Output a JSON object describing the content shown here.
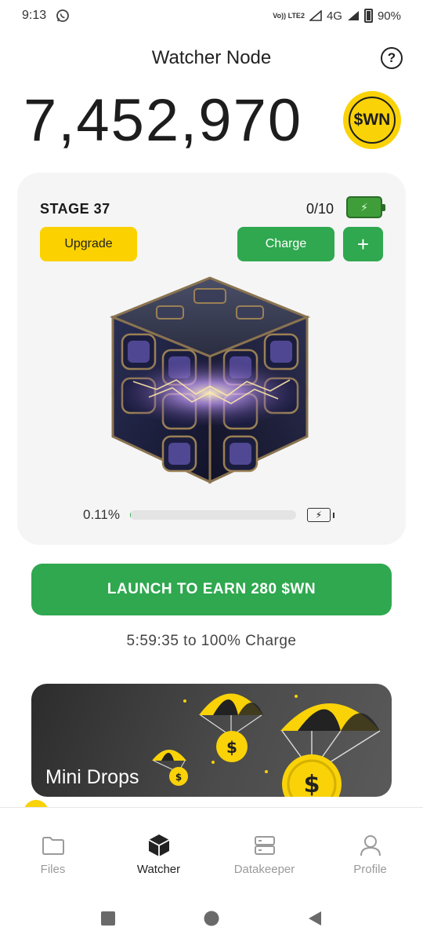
{
  "status_bar": {
    "time": "9:13",
    "volte": "Vo)) LTE2",
    "network": "4G",
    "battery": "90%"
  },
  "header": {
    "title": "Watcher Node",
    "help_icon": "question-circle-icon"
  },
  "balance": {
    "value": "7,452,970",
    "coin_label": "$WN"
  },
  "node": {
    "stage": "STAGE 37",
    "charges": "0/10",
    "upgrade_label": "Upgrade",
    "charge_label": "Charge",
    "plus_label": "+",
    "progress_text": "0.11%",
    "progress_fraction": 0.0011
  },
  "launch": {
    "label": "LAUNCH TO EARN 280 $WN",
    "timer": "5:59:35 to 100% Charge"
  },
  "banner": {
    "label": "Mini Drops",
    "accent_color": "#f9d208"
  },
  "nav": {
    "items": [
      {
        "label": "Files",
        "icon": "folder-icon"
      },
      {
        "label": "Watcher",
        "icon": "cube-icon"
      },
      {
        "label": "Datakeeper",
        "icon": "server-icon"
      },
      {
        "label": "Profile",
        "icon": "user-icon"
      }
    ],
    "active": "Watcher"
  },
  "colors": {
    "primary_green": "#2fa84f",
    "yellow": "#fbd100",
    "card_bg": "#f5f5f5"
  }
}
